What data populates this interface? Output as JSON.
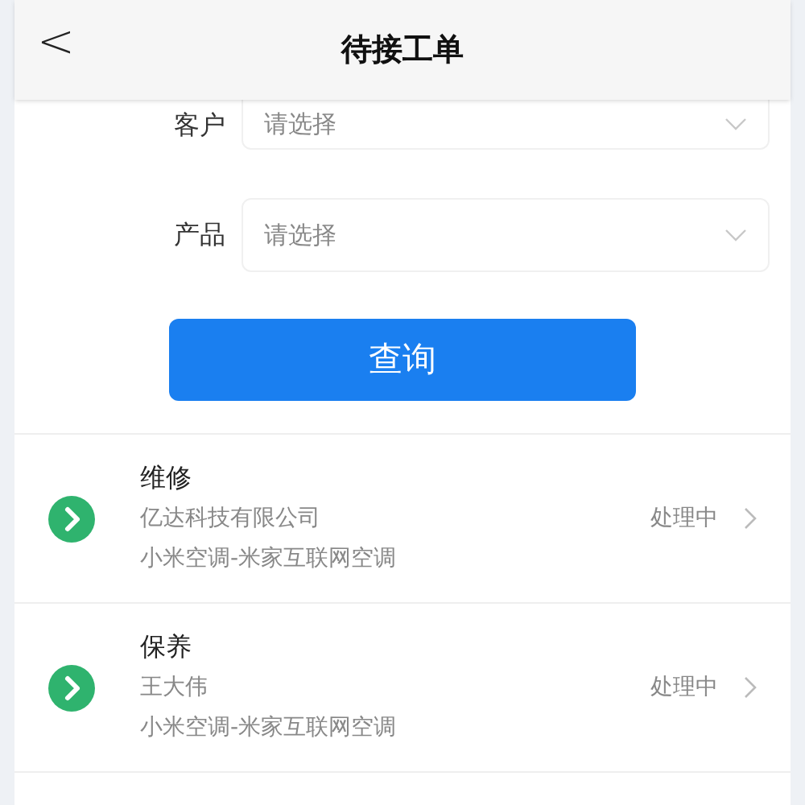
{
  "header": {
    "back": "<",
    "title": "待接工单"
  },
  "filters": [
    {
      "label": "客户",
      "placeholder": "请选择"
    },
    {
      "label": "产品",
      "placeholder": "请选择"
    }
  ],
  "query_button": "查询",
  "orders": [
    {
      "type": "维修",
      "customer": "亿达科技有限公司",
      "product": "小米空调-米家互联网空调",
      "status": "处理中"
    },
    {
      "type": "保养",
      "customer": "王大伟",
      "product": "小米空调-米家互联网空调",
      "status": "处理中"
    }
  ]
}
